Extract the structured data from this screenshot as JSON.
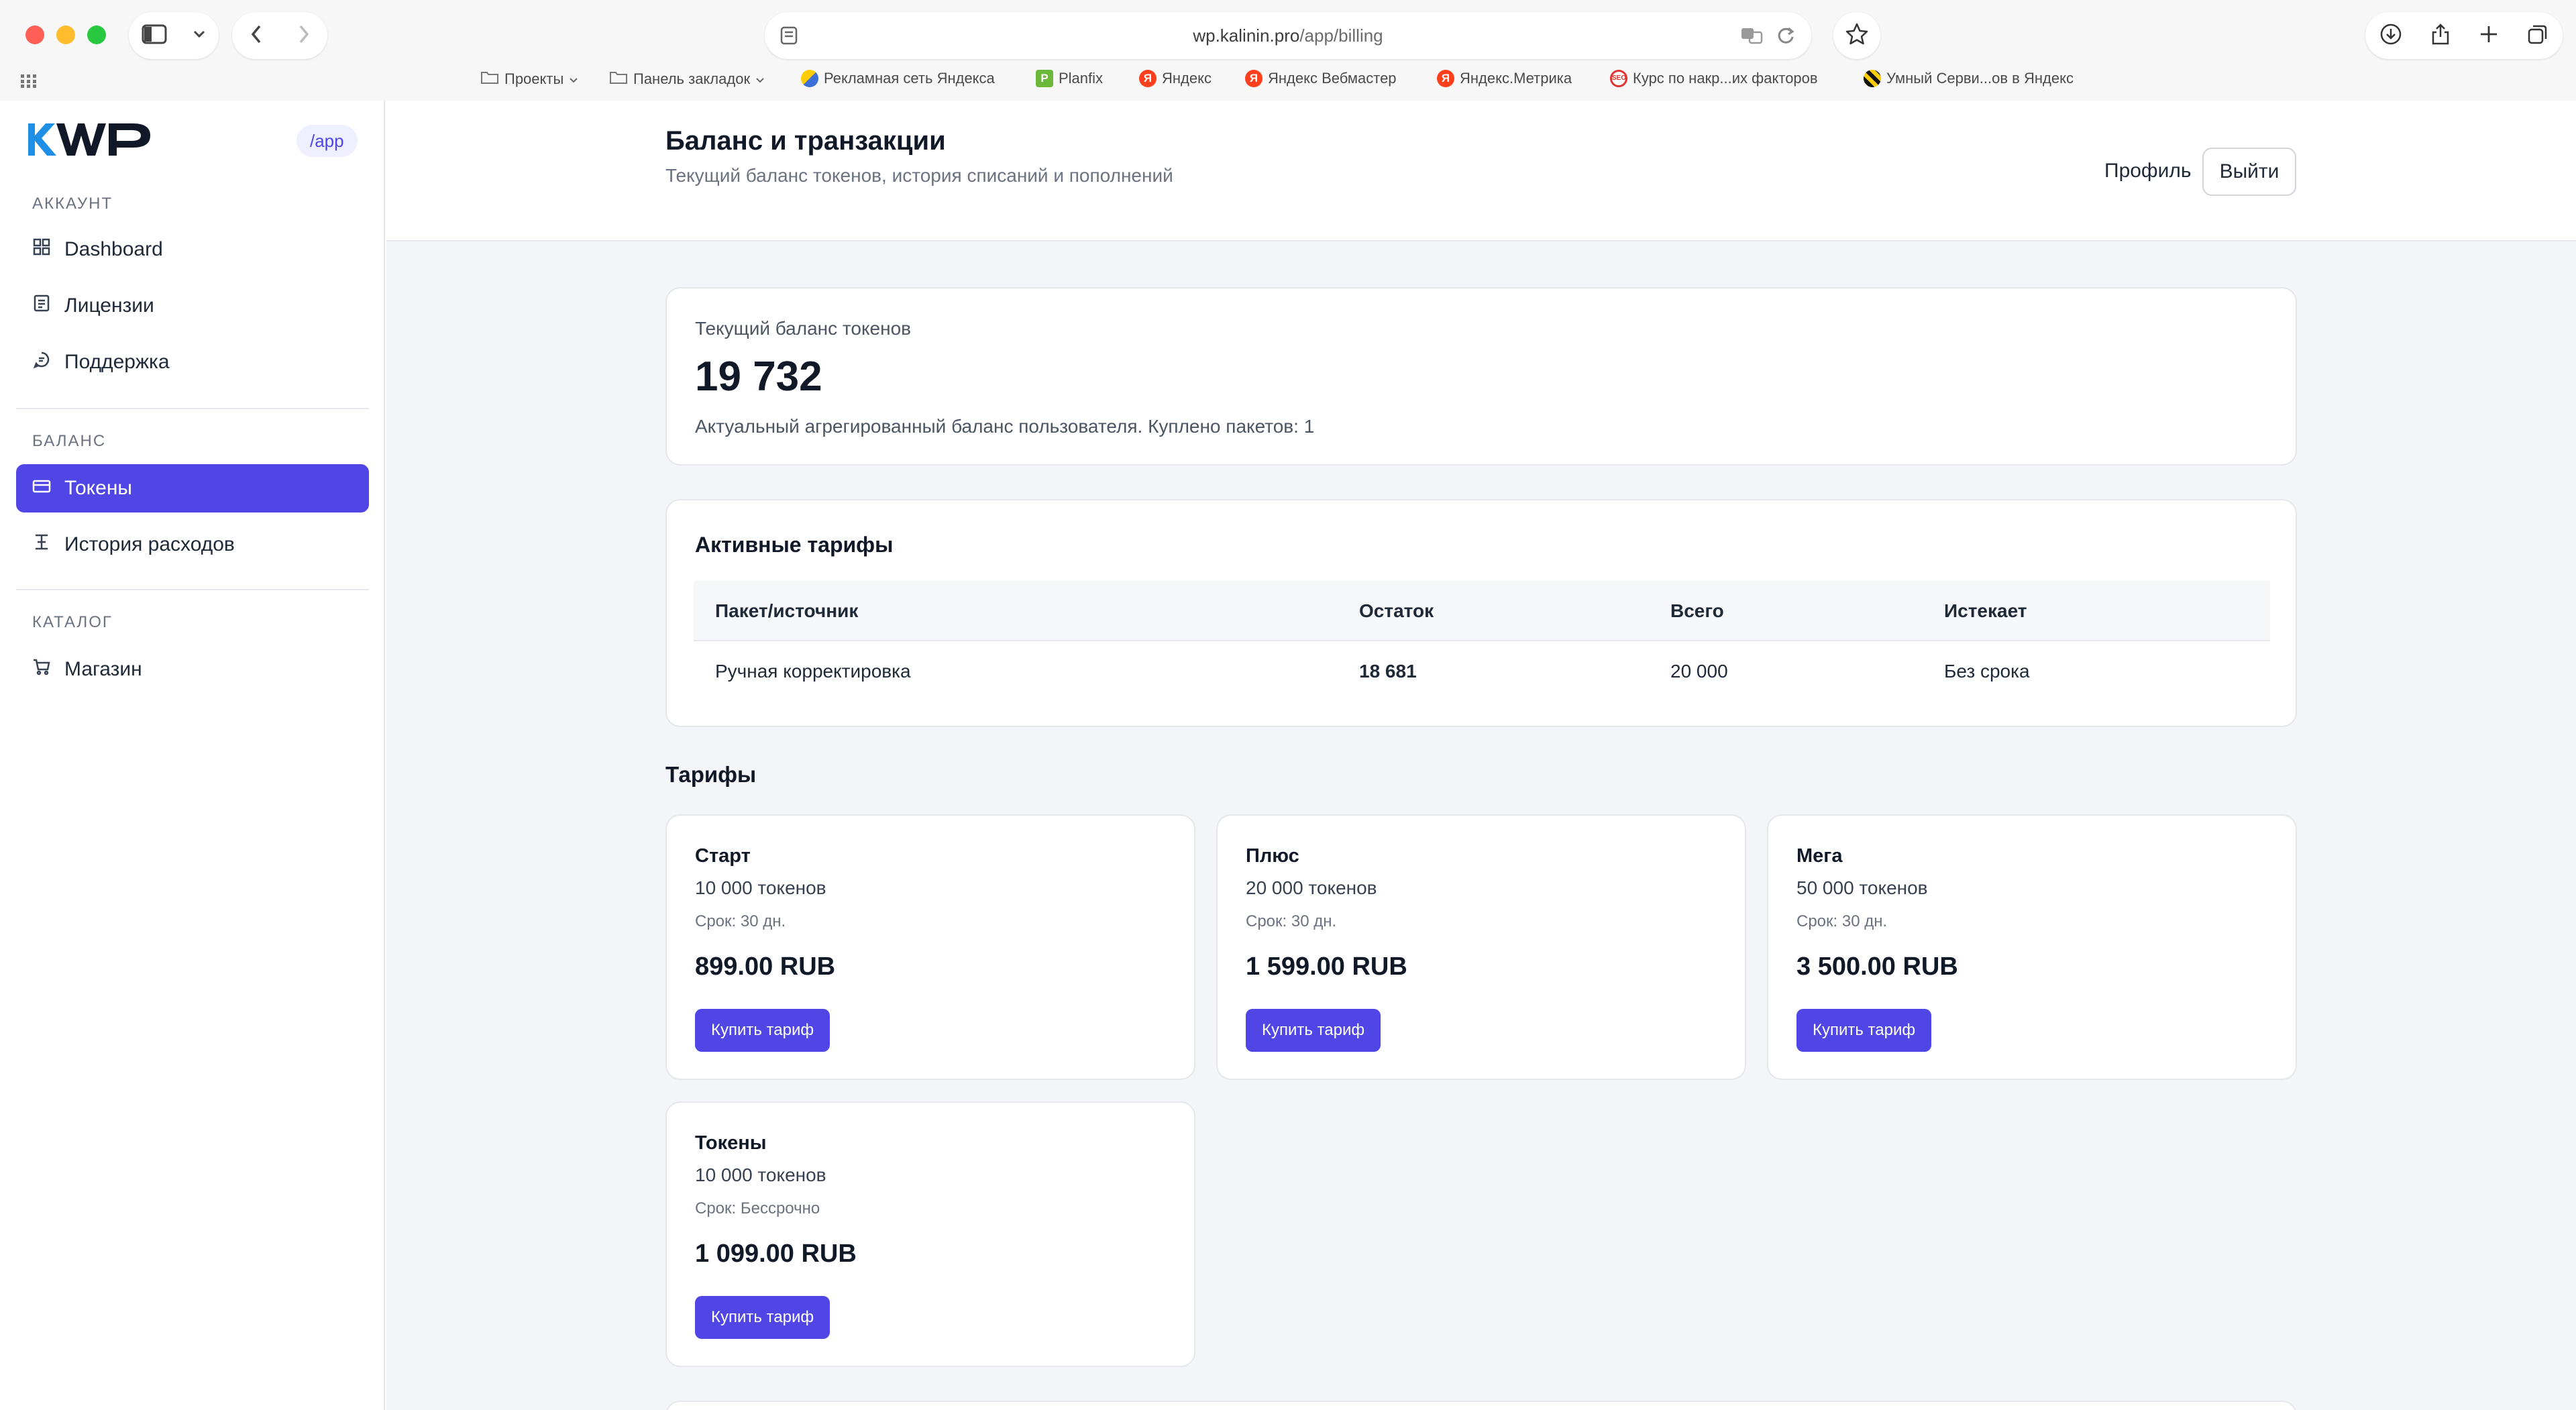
{
  "browser": {
    "url_host": "wp.kalinin.pro",
    "url_path": "/app/billing",
    "bookmarks": [
      {
        "label": "Проекты",
        "icon": "folder-icon"
      },
      {
        "label": "Панель закладок",
        "icon": "folder-icon"
      },
      {
        "label": "Рекламная сеть Яндекса",
        "icon": "rsya-favicon"
      },
      {
        "label": "Planfix",
        "icon": "planfix-favicon"
      },
      {
        "label": "Яндекс",
        "icon": "yandex-favicon"
      },
      {
        "label": "Яндекс Вебмастер",
        "icon": "yandex-favicon"
      },
      {
        "label": "Яндекс.Метрика",
        "icon": "yandex-favicon"
      },
      {
        "label": "Курс по накр...их факторов",
        "icon": "seo-favicon"
      },
      {
        "label": "Умный Серви...ов в Яндекс",
        "icon": "umny-favicon"
      }
    ]
  },
  "sidebar": {
    "badge": "/app",
    "sections": [
      {
        "title": "АККАУНТ",
        "items": [
          {
            "label": "Dashboard",
            "icon": "dashboard-icon"
          },
          {
            "label": "Лицензии",
            "icon": "licenses-icon"
          },
          {
            "label": "Поддержка",
            "icon": "support-icon"
          }
        ]
      },
      {
        "title": "БАЛАНС",
        "items": [
          {
            "label": "Токены",
            "icon": "card-icon",
            "active": true
          },
          {
            "label": "История расходов",
            "icon": "history-icon"
          }
        ]
      },
      {
        "title": "КАТАЛОГ",
        "items": [
          {
            "label": "Магазин",
            "icon": "cart-icon"
          }
        ]
      }
    ]
  },
  "header": {
    "title": "Баланс и транзакции",
    "subtitle": "Текущий баланс токенов, история списаний и пополнений",
    "profile_label": "Профиль",
    "logout_label": "Выйти"
  },
  "balance": {
    "label": "Текущий баланс токенов",
    "value": "19 732",
    "description": "Актуальный агрегированный баланс пользователя. Куплено пакетов: 1"
  },
  "active_tariffs": {
    "title": "Активные тарифы",
    "columns": [
      "Пакет/источник",
      "Остаток",
      "Всего",
      "Истекает"
    ],
    "rows": [
      [
        "Ручная корректировка",
        "18 681",
        "20 000",
        "Без срока"
      ]
    ]
  },
  "plans": {
    "title": "Тарифы",
    "buy_label": "Купить тариф",
    "items": [
      {
        "name": "Старт",
        "tokens": "10 000 токенов",
        "term": "Срок: 30 дн.",
        "price": "899.00 RUB"
      },
      {
        "name": "Плюс",
        "tokens": "20 000 токенов",
        "term": "Срок: 30 дн.",
        "price": "1 599.00 RUB"
      },
      {
        "name": "Мега",
        "tokens": "50 000 токенов",
        "term": "Срок: 30 дн.",
        "price": "3 500.00 RUB"
      },
      {
        "name": "Токены",
        "tokens": "10 000 токенов",
        "term": "Срок: Бессрочно",
        "price": "1 099.00 RUB"
      }
    ]
  },
  "colors": {
    "accent": "#4f46e5",
    "background": "#f4f5f8"
  }
}
